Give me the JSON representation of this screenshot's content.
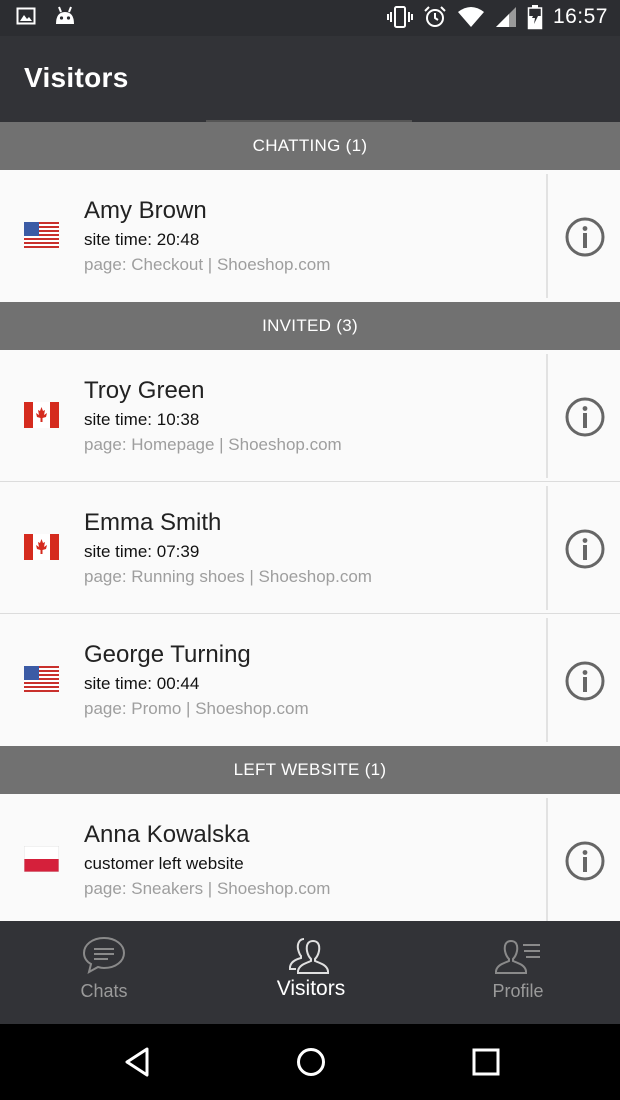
{
  "status_bar": {
    "time": "16:57",
    "left_icons": [
      "image-icon",
      "android-icon"
    ],
    "right_icons": [
      "vibrate-icon",
      "alarm-icon",
      "wifi-icon",
      "signal-icon",
      "battery-icon"
    ]
  },
  "app_bar": {
    "title": "Visitors"
  },
  "sections": [
    {
      "header": "CHATTING (1)",
      "visitors": [
        {
          "name": "Amy Brown",
          "time": "site time: 20:48",
          "page": "page: Checkout | Shoeshop.com",
          "flag": "us"
        }
      ]
    },
    {
      "header": "INVITED (3)",
      "visitors": [
        {
          "name": "Troy Green",
          "time": "site time: 10:38",
          "page": "page: Homepage | Shoeshop.com",
          "flag": "ca"
        },
        {
          "name": "Emma Smith",
          "time": "site time: 07:39",
          "page": "page: Running shoes | Shoeshop.com",
          "flag": "ca"
        },
        {
          "name": "George Turning",
          "time": "site time: 00:44",
          "page": "page: Promo | Shoeshop.com",
          "flag": "us"
        }
      ]
    },
    {
      "header": "LEFT WEBSITE (1)",
      "visitors": [
        {
          "name": "Anna Kowalska",
          "time": "customer left website",
          "page": "page: Sneakers | Shoeshop.com",
          "flag": "pl"
        }
      ]
    }
  ],
  "bottom_nav": {
    "chats": "Chats",
    "visitors": "Visitors",
    "profile": "Profile",
    "active": "visitors"
  },
  "system_nav": [
    "back-icon",
    "home-icon",
    "recents-icon"
  ],
  "colors": {
    "app_bar": "#323337",
    "section_header": "#717171",
    "row_bg": "#fafafa",
    "secondary_text": "#9e9e9e",
    "active_nav": "#ffffff",
    "inactive_nav": "#9a9a9a"
  }
}
